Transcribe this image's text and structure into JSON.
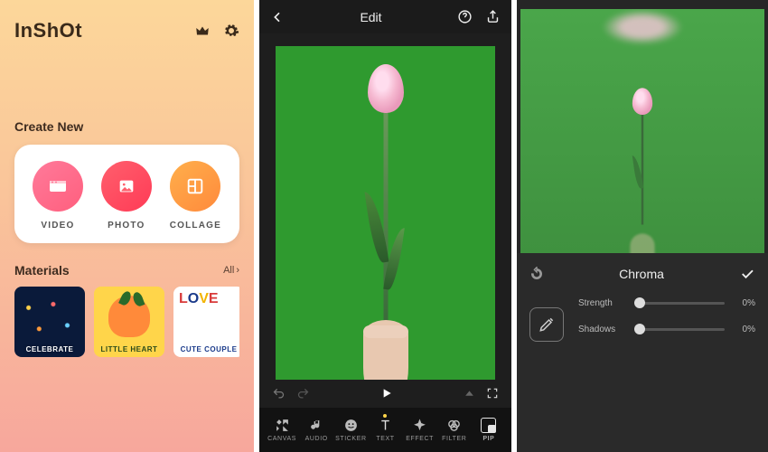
{
  "home": {
    "app_name": "InShOt",
    "create_heading": "Create New",
    "new_buttons": [
      {
        "label": "VIDEO"
      },
      {
        "label": "PHOTO"
      },
      {
        "label": "COLLAGE"
      }
    ],
    "materials_heading": "Materials",
    "materials_all": "All",
    "materials": [
      {
        "label": "CELEBRATE"
      },
      {
        "label": "LITTLE HEART"
      },
      {
        "label": "CUTE COUPLE"
      }
    ]
  },
  "editor": {
    "title": "Edit",
    "tools": [
      {
        "label": "CANVAS"
      },
      {
        "label": "AUDIO"
      },
      {
        "label": "STICKER"
      },
      {
        "label": "TEXT"
      },
      {
        "label": "EFFECT"
      },
      {
        "label": "FILTER"
      },
      {
        "label": "PIP"
      }
    ]
  },
  "chroma": {
    "title": "Chroma",
    "sliders": [
      {
        "label": "Strength",
        "value": "0%"
      },
      {
        "label": "Shadows",
        "value": "0%"
      }
    ]
  }
}
